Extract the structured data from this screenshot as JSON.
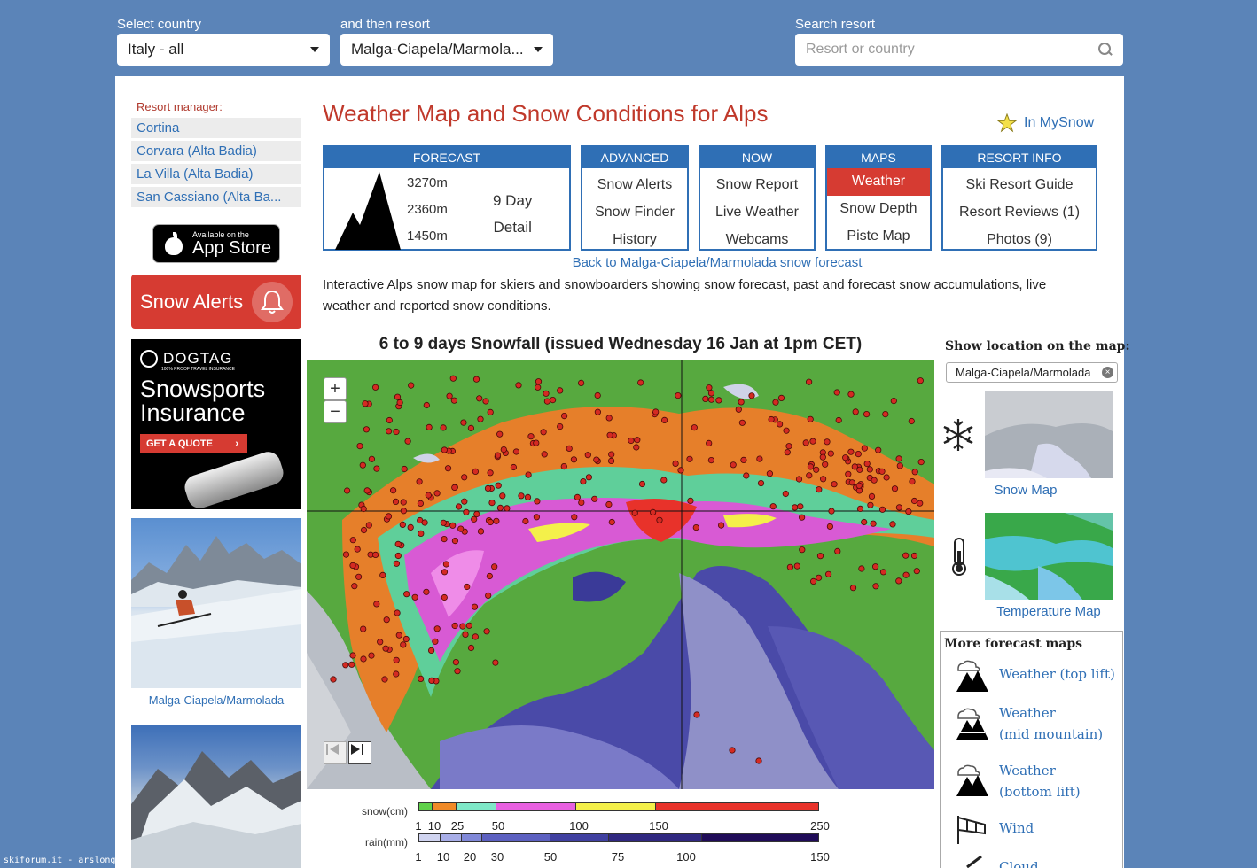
{
  "topbar": {
    "country_label": "Select country",
    "country_value": "Italy - all",
    "resort_label": "and then resort",
    "resort_value": "Malga-Ciapela/Marmola...",
    "search_label": "Search resort",
    "search_placeholder": "Resort or country"
  },
  "sidebar": {
    "manager_label": "Resort manager:",
    "managers": [
      "Cortina",
      "Corvara (Alta Badia)",
      "La Villa (Alta Badia)",
      "San Cassiano (Alta Ba..."
    ],
    "appstore_small": "Available on the",
    "appstore_big": "App Store",
    "alerts_label": "Snow Alerts",
    "ad": {
      "brand": "DOGTAG",
      "tagline": "100% PROOF TRAVEL INSURANCE",
      "title_line1": "Snowsports",
      "title_line2": "Insurance",
      "cta": "GET A QUOTE"
    },
    "photo_caption": "Malga-Ciapela/Marmolada"
  },
  "header": {
    "title": "Weather Map and Snow Conditions for Alps",
    "mysnow": "In MySnow"
  },
  "menus": {
    "forecast": {
      "head": "FORECAST",
      "elevations": [
        "3270m",
        "2360m",
        "1450m"
      ],
      "nine_day_1": "9 Day",
      "nine_day_2": "Detail"
    },
    "advanced": {
      "head": "ADVANCED",
      "items": [
        "Snow Alerts",
        "Snow Finder",
        "History"
      ]
    },
    "now": {
      "head": "NOW",
      "items": [
        "Snow Report",
        "Live Weather",
        "Webcams"
      ]
    },
    "maps": {
      "head": "MAPS",
      "items": [
        "Weather",
        "Snow Depth",
        "Piste Map"
      ],
      "active": "Weather"
    },
    "resort_info": {
      "head": "RESORT INFO",
      "items": [
        "Ski Resort Guide",
        "Resort Reviews (1)",
        "Photos (9)"
      ]
    }
  },
  "back_link": "Back to Malga-Ciapela/Marmolada snow forecast",
  "intro": "Interactive Alps snow map for skiers and snowboarders showing snow forecast, past and forecast snow accumulations, live weather and reported snow conditions.",
  "map": {
    "title": "6 to 9 days Snowfall (issued Wednesday 16 Jan at 1pm CET)",
    "zoom_in": "+",
    "zoom_out": "−",
    "legend": {
      "snow_label": "snow(cm)",
      "rain_label": "rain(mm)",
      "snow_ticks": [
        "1",
        "10",
        "25",
        "50",
        "100",
        "150",
        "250"
      ],
      "rain_ticks": [
        "1",
        "10",
        "20",
        "30",
        "50",
        "75",
        "100",
        "150"
      ],
      "snow_colors": [
        "#5fd14a",
        "#f08a28",
        "#7fe8c8",
        "#e860e0",
        "#f4f04a",
        "#e8322a"
      ],
      "rain_colors": [
        "#d0d4f0",
        "#a8aee8",
        "#8088d8",
        "#5c60c0",
        "#4040a0",
        "#302880",
        "#200c58"
      ]
    }
  },
  "right": {
    "show_location": "Show location on the map:",
    "location_value": "Malga-Ciapela/Marmolada",
    "snow_map": "Snow Map",
    "temperature_map": "Temperature Map",
    "more_title": "More forecast maps",
    "more": [
      {
        "line1": "Weather (top lift)",
        "line2": ""
      },
      {
        "line1": "Weather",
        "line2": "(mid mountain)"
      },
      {
        "line1": "Weather",
        "line2": "(bottom lift)"
      },
      {
        "line1": "Wind",
        "line2": ""
      },
      {
        "line1": "Cloud",
        "line2": ""
      }
    ]
  },
  "footer_credit": "skiforum.it - arslonga"
}
